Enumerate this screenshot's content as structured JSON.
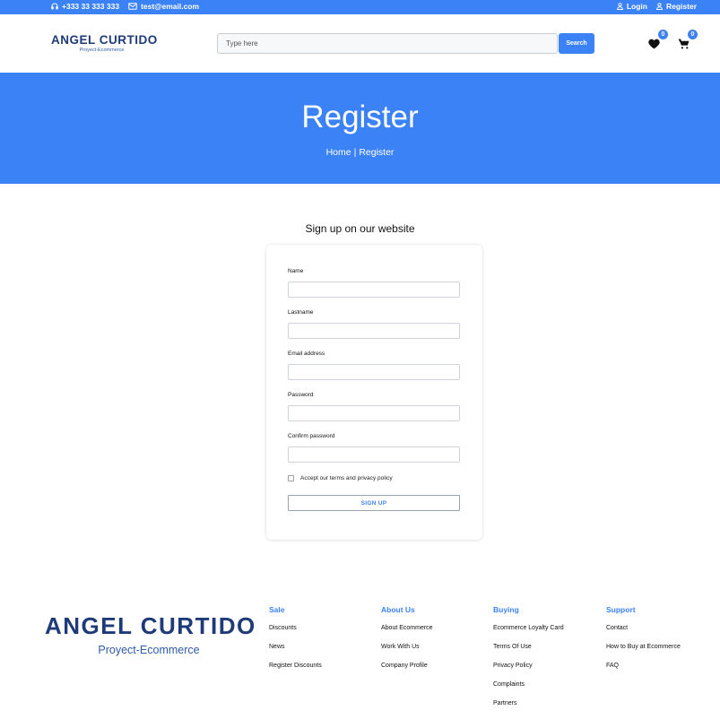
{
  "topbar": {
    "phone": "+333 33 333 333",
    "email": "test@email.com",
    "login": "Login",
    "register": "Register"
  },
  "header": {
    "brand": "ANGEL CURTIDO",
    "brand_sub": "Proyect-Ecommerce",
    "search_placeholder": "Type here",
    "search_button": "Search",
    "wishlist_count": "0",
    "cart_count": "0"
  },
  "hero": {
    "title": "Register",
    "breadcrumb": [
      "Home",
      "|",
      "Register"
    ]
  },
  "form": {
    "heading": "Sign up on our website",
    "fields": [
      {
        "label": "Name",
        "value": ""
      },
      {
        "label": "Lastname",
        "value": ""
      },
      {
        "label": "Email address",
        "value": ""
      },
      {
        "label": "Password",
        "value": ""
      },
      {
        "label": "Confirm password",
        "value": ""
      }
    ],
    "terms": "Accept our terms and privacy policy",
    "submit": "SIGN UP"
  },
  "footer": {
    "brand": "ANGEL CURTIDO",
    "brand_sub": "Proyect-Ecommerce",
    "columns": [
      {
        "title": "Sale",
        "links": [
          "Discounts",
          "News",
          "Register Discounts"
        ]
      },
      {
        "title": "About Us",
        "links": [
          "About Ecommerce",
          "Work With Us",
          "Company Profile"
        ]
      },
      {
        "title": "Buying",
        "links": [
          "Ecommerce Loyalty Card",
          "Terms Of Use",
          "Privacy Policy",
          "Complaints",
          "Partners"
        ]
      },
      {
        "title": "Support",
        "links": [
          "Contact",
          "How to Buy at Ecommerce",
          "FAQ"
        ]
      }
    ]
  },
  "colors": {
    "primary": "#3b82f6",
    "brand_navy": "#1e3a78"
  }
}
